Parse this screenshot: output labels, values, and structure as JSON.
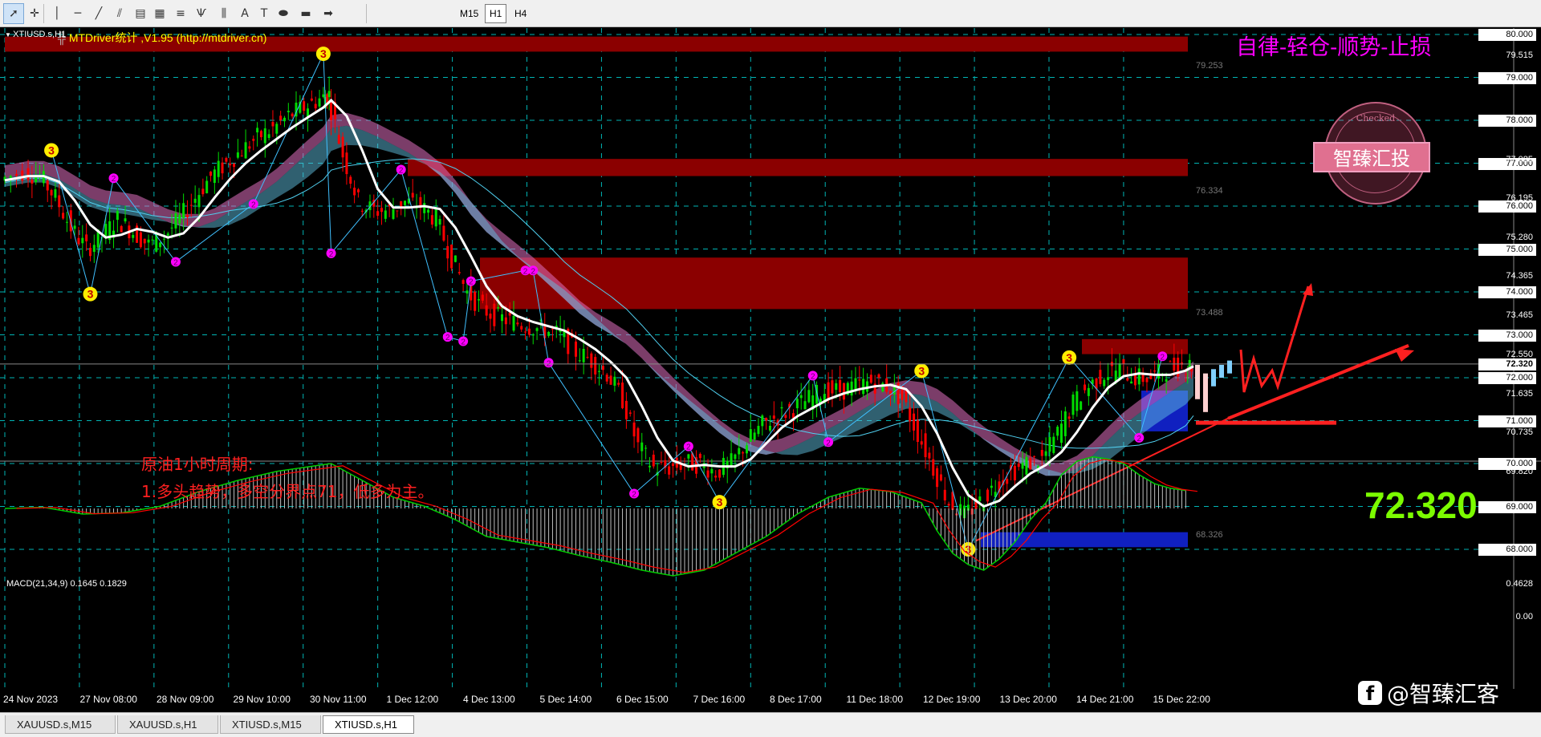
{
  "toolbar": {
    "tools": [
      {
        "name": "cursor-icon",
        "glyph": "➚"
      },
      {
        "name": "crosshair-icon",
        "glyph": "✛"
      },
      {
        "name": "vertical-line-icon",
        "glyph": "│"
      },
      {
        "name": "horizontal-line-icon",
        "glyph": "─"
      },
      {
        "name": "trendline-icon",
        "glyph": "╱"
      },
      {
        "name": "parallel-channel-icon",
        "glyph": "⫽"
      },
      {
        "name": "regression-channel-icon",
        "glyph": "▤"
      },
      {
        "name": "gann-icon",
        "glyph": "▦"
      },
      {
        "name": "fibonacci-icon",
        "glyph": "≡"
      },
      {
        "name": "pitchfork-icon",
        "glyph": "Ѱ"
      },
      {
        "name": "cycle-lines-icon",
        "glyph": "⫼"
      },
      {
        "name": "text-icon",
        "glyph": "A"
      },
      {
        "name": "text-label-icon",
        "glyph": "T"
      },
      {
        "name": "ellipse-icon",
        "glyph": "⬬"
      },
      {
        "name": "rectangle-icon",
        "glyph": "▬"
      },
      {
        "name": "arrow-icon",
        "glyph": "➡"
      }
    ],
    "timeframes": [
      "M15",
      "H1",
      "H4"
    ],
    "active_timeframe": "H1"
  },
  "chart": {
    "symbol_title": "XTIUSD.s,H1",
    "indicator_header": "MTDriver统计 ,V1.95 (http://mtdriver.cn)",
    "motto": "自律-轻仓-顺势-止损",
    "stamp_text": "智臻汇投",
    "stamp_ring_text": "Checked",
    "annotation_line1": "原油1小时周期:",
    "annotation_line2": "1.多头趋势，多空分界点71，低多为主。",
    "current_price": "72.320",
    "macd_label": "MACD(21,34,9) 0.1645 0.1829",
    "watermark": "@智臻汇客",
    "colors": {
      "supply_zone": "#8b0000",
      "demand_zone": "#1020c0",
      "bull_candle": "#00dd00",
      "bear_candle": "#ff0000",
      "price_ma": "#ffffff",
      "cloud_pink": "#e070c0",
      "cloud_blue": "#60c0e0",
      "zigzag_3": "#ffee00",
      "zigzag_2": "#ff00ff",
      "macd_hist": "#c0c0c0",
      "macd_signal": "#ff0000",
      "macd_line": "#00cc00",
      "grid": "#00b4b4",
      "motto": "#ff00ff",
      "annotation": "#ff2020",
      "big_price": "#7cfc00"
    }
  },
  "price_axis": [
    {
      "label": "80.000",
      "kind": "grid"
    },
    {
      "label": "79.000",
      "kind": "grid"
    },
    {
      "label": "78.000",
      "kind": "grid"
    },
    {
      "label": "77.000",
      "kind": "grid"
    },
    {
      "label": "76.000",
      "kind": "grid"
    },
    {
      "label": "75.000",
      "kind": "grid"
    },
    {
      "label": "74.000",
      "kind": "grid"
    },
    {
      "label": "73.000",
      "kind": "grid"
    },
    {
      "label": "72.000",
      "kind": "grid"
    },
    {
      "label": "71.000",
      "kind": "grid"
    },
    {
      "label": "70.000",
      "kind": "grid"
    },
    {
      "label": "69.000",
      "kind": "grid"
    },
    {
      "label": "68.000",
      "kind": "grid"
    }
  ],
  "price_axis_minor": [
    "79.515",
    "77.085",
    "76.195",
    "75.280",
    "74.365",
    "73.465",
    "72.550",
    "71.635",
    "70.735",
    "69.820"
  ],
  "zone_labels": [
    "79.253",
    "76.334",
    "73.488",
    "68.326"
  ],
  "macd_axis": [
    "0.4628",
    "0.00"
  ],
  "time_axis": [
    "24 Nov 2023",
    "27 Nov 08:00",
    "28 Nov 09:00",
    "29 Nov 10:00",
    "30 Nov 11:00",
    "1 Dec 12:00",
    "4 Dec 13:00",
    "5 Dec 14:00",
    "6 Dec 15:00",
    "7 Dec 16:00",
    "8 Dec 17:00",
    "11 Dec 18:00",
    "12 Dec 19:00",
    "13 Dec 20:00",
    "14 Dec 21:00",
    "15 Dec 22:00"
  ],
  "tabs": [
    "XAUUSD.s,M15",
    "XAUUSD.s,H1",
    "XTIUSD.s,M15",
    "XTIUSD.s,H1"
  ],
  "active_tab": "XTIUSD.s,H1",
  "price_path": [
    [
      0,
      76.6
    ],
    [
      3,
      76.8
    ],
    [
      5,
      76.7
    ],
    [
      7,
      76.2
    ],
    [
      9,
      75.5
    ],
    [
      11,
      75.0
    ],
    [
      13,
      75.3
    ],
    [
      15,
      75.7
    ],
    [
      17,
      75.4
    ],
    [
      19,
      75.1
    ],
    [
      21,
      75.3
    ],
    [
      23,
      75.7
    ],
    [
      25,
      76.2
    ],
    [
      27,
      76.7
    ],
    [
      29,
      77.0
    ],
    [
      31,
      77.3
    ],
    [
      33,
      77.6
    ],
    [
      35,
      77.8
    ],
    [
      37,
      78.1
    ],
    [
      39,
      78.3
    ],
    [
      41,
      78.5
    ],
    [
      42,
      78.6
    ],
    [
      44,
      77.2
    ],
    [
      46,
      76.1
    ],
    [
      48,
      75.9
    ],
    [
      50,
      75.9
    ],
    [
      52,
      76.1
    ],
    [
      54,
      76.0
    ],
    [
      56,
      75.7
    ],
    [
      58,
      74.8
    ],
    [
      60,
      74.0
    ],
    [
      62,
      73.6
    ],
    [
      64,
      73.4
    ],
    [
      66,
      73.3
    ],
    [
      68,
      73.2
    ],
    [
      70,
      73.1
    ],
    [
      72,
      73.0
    ],
    [
      74,
      72.6
    ],
    [
      76,
      72.4
    ],
    [
      78,
      72.1
    ],
    [
      80,
      71.5
    ],
    [
      82,
      70.4
    ],
    [
      84,
      69.9
    ],
    [
      86,
      69.9
    ],
    [
      88,
      70.0
    ],
    [
      90,
      70.0
    ],
    [
      92,
      69.8
    ],
    [
      94,
      70.0
    ],
    [
      96,
      70.5
    ],
    [
      98,
      70.9
    ],
    [
      100,
      71.1
    ],
    [
      102,
      71.3
    ],
    [
      104,
      71.5
    ],
    [
      106,
      71.7
    ],
    [
      108,
      71.7
    ],
    [
      110,
      71.8
    ],
    [
      112,
      71.9
    ],
    [
      114,
      71.8
    ],
    [
      116,
      71.5
    ],
    [
      118,
      70.7
    ],
    [
      120,
      69.9
    ],
    [
      122,
      69.1
    ],
    [
      124,
      68.8
    ],
    [
      126,
      69.1
    ],
    [
      128,
      69.5
    ],
    [
      130,
      69.8
    ],
    [
      132,
      70.0
    ],
    [
      134,
      70.1
    ],
    [
      136,
      70.7
    ],
    [
      138,
      71.4
    ],
    [
      140,
      71.8
    ],
    [
      142,
      72.1
    ],
    [
      144,
      72.2
    ],
    [
      146,
      72.0
    ],
    [
      148,
      72.0
    ],
    [
      150,
      72.2
    ],
    [
      152,
      72.3
    ],
    [
      153,
      72.3
    ]
  ],
  "zigzag_3": [
    [
      6,
      77.3
    ],
    [
      11,
      73.95
    ],
    [
      41,
      79.55
    ],
    [
      92,
      69.1
    ],
    [
      118,
      72.16
    ],
    [
      124,
      68.0
    ],
    [
      137,
      72.47
    ]
  ],
  "zigzag_2": [
    [
      14,
      76.65
    ],
    [
      22,
      74.7
    ],
    [
      32,
      76.05
    ],
    [
      42,
      74.9
    ],
    [
      51,
      76.85
    ],
    [
      57,
      72.95
    ],
    [
      59,
      72.85
    ],
    [
      60,
      74.25
    ],
    [
      67,
      74.5
    ],
    [
      68,
      74.5
    ],
    [
      70,
      72.35
    ],
    [
      81,
      69.3
    ],
    [
      88,
      70.4
    ],
    [
      104,
      72.05
    ],
    [
      106,
      70.5
    ],
    [
      146,
      70.6
    ],
    [
      149,
      72.5
    ]
  ],
  "macd": [
    [
      0,
      0.0
    ],
    [
      5,
      0.01
    ],
    [
      10,
      -0.05
    ],
    [
      15,
      -0.04
    ],
    [
      20,
      0.02
    ],
    [
      25,
      0.15
    ],
    [
      30,
      0.25
    ],
    [
      35,
      0.33
    ],
    [
      40,
      0.38
    ],
    [
      42,
      0.4
    ],
    [
      46,
      0.25
    ],
    [
      50,
      0.1
    ],
    [
      54,
      0.02
    ],
    [
      58,
      -0.1
    ],
    [
      62,
      -0.25
    ],
    [
      66,
      -0.3
    ],
    [
      70,
      -0.35
    ],
    [
      74,
      -0.42
    ],
    [
      78,
      -0.48
    ],
    [
      82,
      -0.55
    ],
    [
      86,
      -0.6
    ],
    [
      90,
      -0.55
    ],
    [
      94,
      -0.4
    ],
    [
      98,
      -0.25
    ],
    [
      102,
      -0.05
    ],
    [
      106,
      0.1
    ],
    [
      110,
      0.18
    ],
    [
      114,
      0.15
    ],
    [
      118,
      0.05
    ],
    [
      120,
      -0.2
    ],
    [
      122,
      -0.4
    ],
    [
      124,
      -0.5
    ],
    [
      126,
      -0.55
    ],
    [
      128,
      -0.45
    ],
    [
      130,
      -0.3
    ],
    [
      132,
      -0.1
    ],
    [
      134,
      0.05
    ],
    [
      136,
      0.3
    ],
    [
      138,
      0.42
    ],
    [
      140,
      0.46
    ],
    [
      142,
      0.44
    ],
    [
      144,
      0.4
    ],
    [
      146,
      0.3
    ],
    [
      148,
      0.22
    ],
    [
      150,
      0.18
    ],
    [
      152,
      0.16
    ]
  ]
}
